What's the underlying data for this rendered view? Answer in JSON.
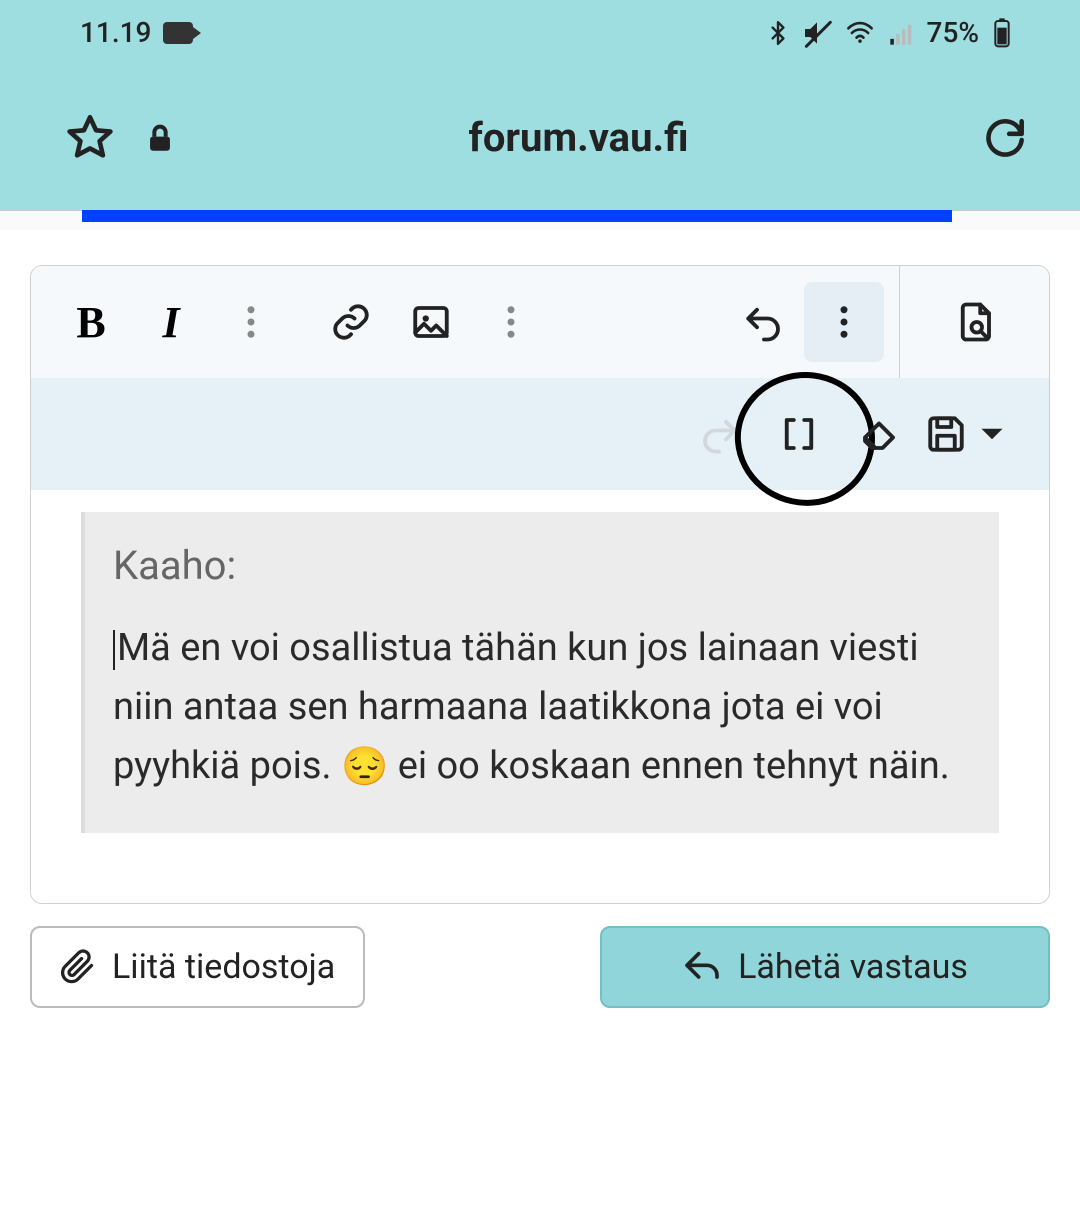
{
  "status_bar": {
    "time": "11.19",
    "battery_text": "75%"
  },
  "browser": {
    "url": "forum.vau.fi"
  },
  "editor": {
    "toolbar": {
      "bold": "B",
      "italic": "I"
    },
    "quote": {
      "author_label": "Kaaho:",
      "body_before_emoji": "Mä en voi osallistua tähän kun jos lainaan viesti niin antaa sen harmaana laatikkona jota ei voi pyyhkiä pois. ",
      "emoji": "😔",
      "body_after_emoji": " ei oo koskaan ennen tehnyt näin."
    }
  },
  "actions": {
    "attach_label": "Liitä tiedostoja",
    "submit_label": "Lähetä vastaus"
  }
}
